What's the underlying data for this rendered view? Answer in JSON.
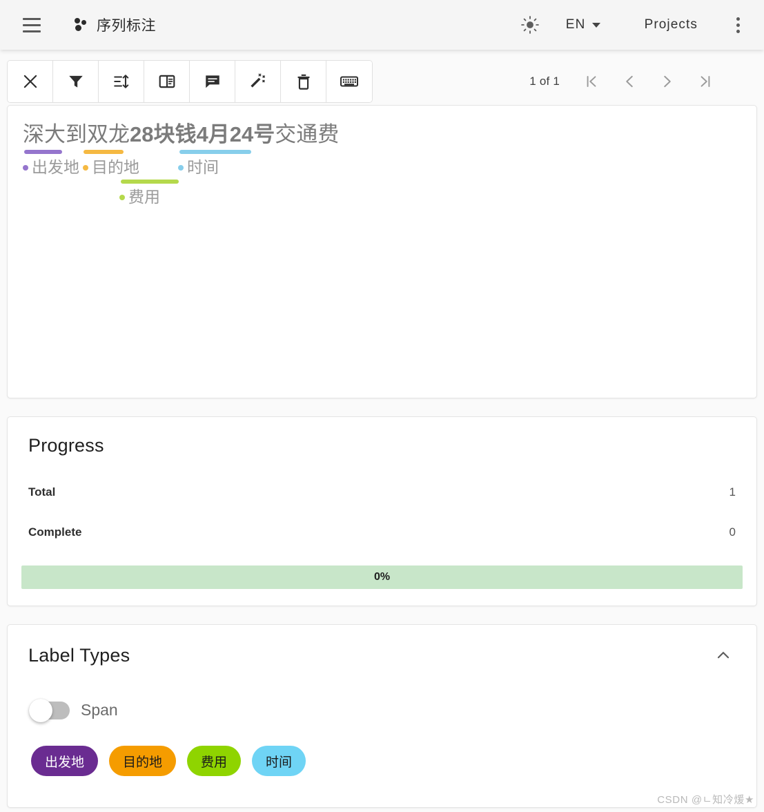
{
  "header": {
    "menu_icon": "hamburger-icon",
    "logo_icon": "doccano-logo-icon",
    "title": "序列标注",
    "theme_icon": "sun-icon",
    "language": "EN",
    "language_caret_icon": "caret-down-icon",
    "projects_label": "Projects",
    "kebab_icon": "more-vertical-icon"
  },
  "toolbar": {
    "buttons": [
      {
        "name": "close-button",
        "icon": "close-icon",
        "label": "Close"
      },
      {
        "name": "filter-button",
        "icon": "filter-icon",
        "label": "Filter"
      },
      {
        "name": "sort-button",
        "icon": "sort-icon",
        "label": "Sort"
      },
      {
        "name": "guideline-button",
        "icon": "guideline-icon",
        "label": "Guideline"
      },
      {
        "name": "comment-button",
        "icon": "comment-icon",
        "label": "Comment"
      },
      {
        "name": "auto-label-button",
        "icon": "magic-wand-icon",
        "label": "Auto label"
      },
      {
        "name": "delete-button",
        "icon": "trash-icon",
        "label": "Delete"
      },
      {
        "name": "keyboard-button",
        "icon": "keyboard-icon",
        "label": "Keyboard shortcuts"
      }
    ]
  },
  "pagination": {
    "status": "1 of 1",
    "first_icon": "first-page-icon",
    "prev_icon": "chevron-left-icon",
    "next_icon": "chevron-right-icon",
    "last_icon": "last-page-icon"
  },
  "document": {
    "text": "深大到双龙28块钱4月24号交通费",
    "segments": [
      {
        "text": "深大",
        "bold": false
      },
      {
        "text": "到",
        "bold": false
      },
      {
        "text": "双龙",
        "bold": false
      },
      {
        "text": "28块钱",
        "bold": true
      },
      {
        "text": "4月24号",
        "bold": true
      },
      {
        "text": "交通费",
        "bold": false
      }
    ],
    "annotations": [
      {
        "text": "深大",
        "label": "出发地",
        "color": "#9575cd",
        "row": 1
      },
      {
        "text": "双龙",
        "label": "目的地",
        "color": "#f5b942",
        "row": 1
      },
      {
        "text": "4月24号",
        "label": "时间",
        "color": "#87ceeb",
        "row": 1
      },
      {
        "text": "28块钱",
        "label": "费用",
        "color": "#b5d94c",
        "row": 2
      }
    ]
  },
  "progress": {
    "title": "Progress",
    "total_label": "Total",
    "total_value": "1",
    "complete_label": "Complete",
    "complete_value": "0",
    "percent_text": "0%",
    "percent_value": 0,
    "bar_color": "#c8e6c9"
  },
  "label_types": {
    "title": "Label Types",
    "collapse_icon": "chevron-up-icon",
    "span_toggle": {
      "label": "Span",
      "enabled": false
    },
    "chips": [
      {
        "text": "出发地",
        "bg": "#6a2c91",
        "fg": "#ffffff"
      },
      {
        "text": "目的地",
        "bg": "#f59c00",
        "fg": "#1a1a1a"
      },
      {
        "text": "费用",
        "bg": "#8fd400",
        "fg": "#1a1a1a"
      },
      {
        "text": "时间",
        "bg": "#6fd4f5",
        "fg": "#1a1a1a"
      }
    ]
  },
  "watermark": "CSDN @ㄴ知冷煖★"
}
